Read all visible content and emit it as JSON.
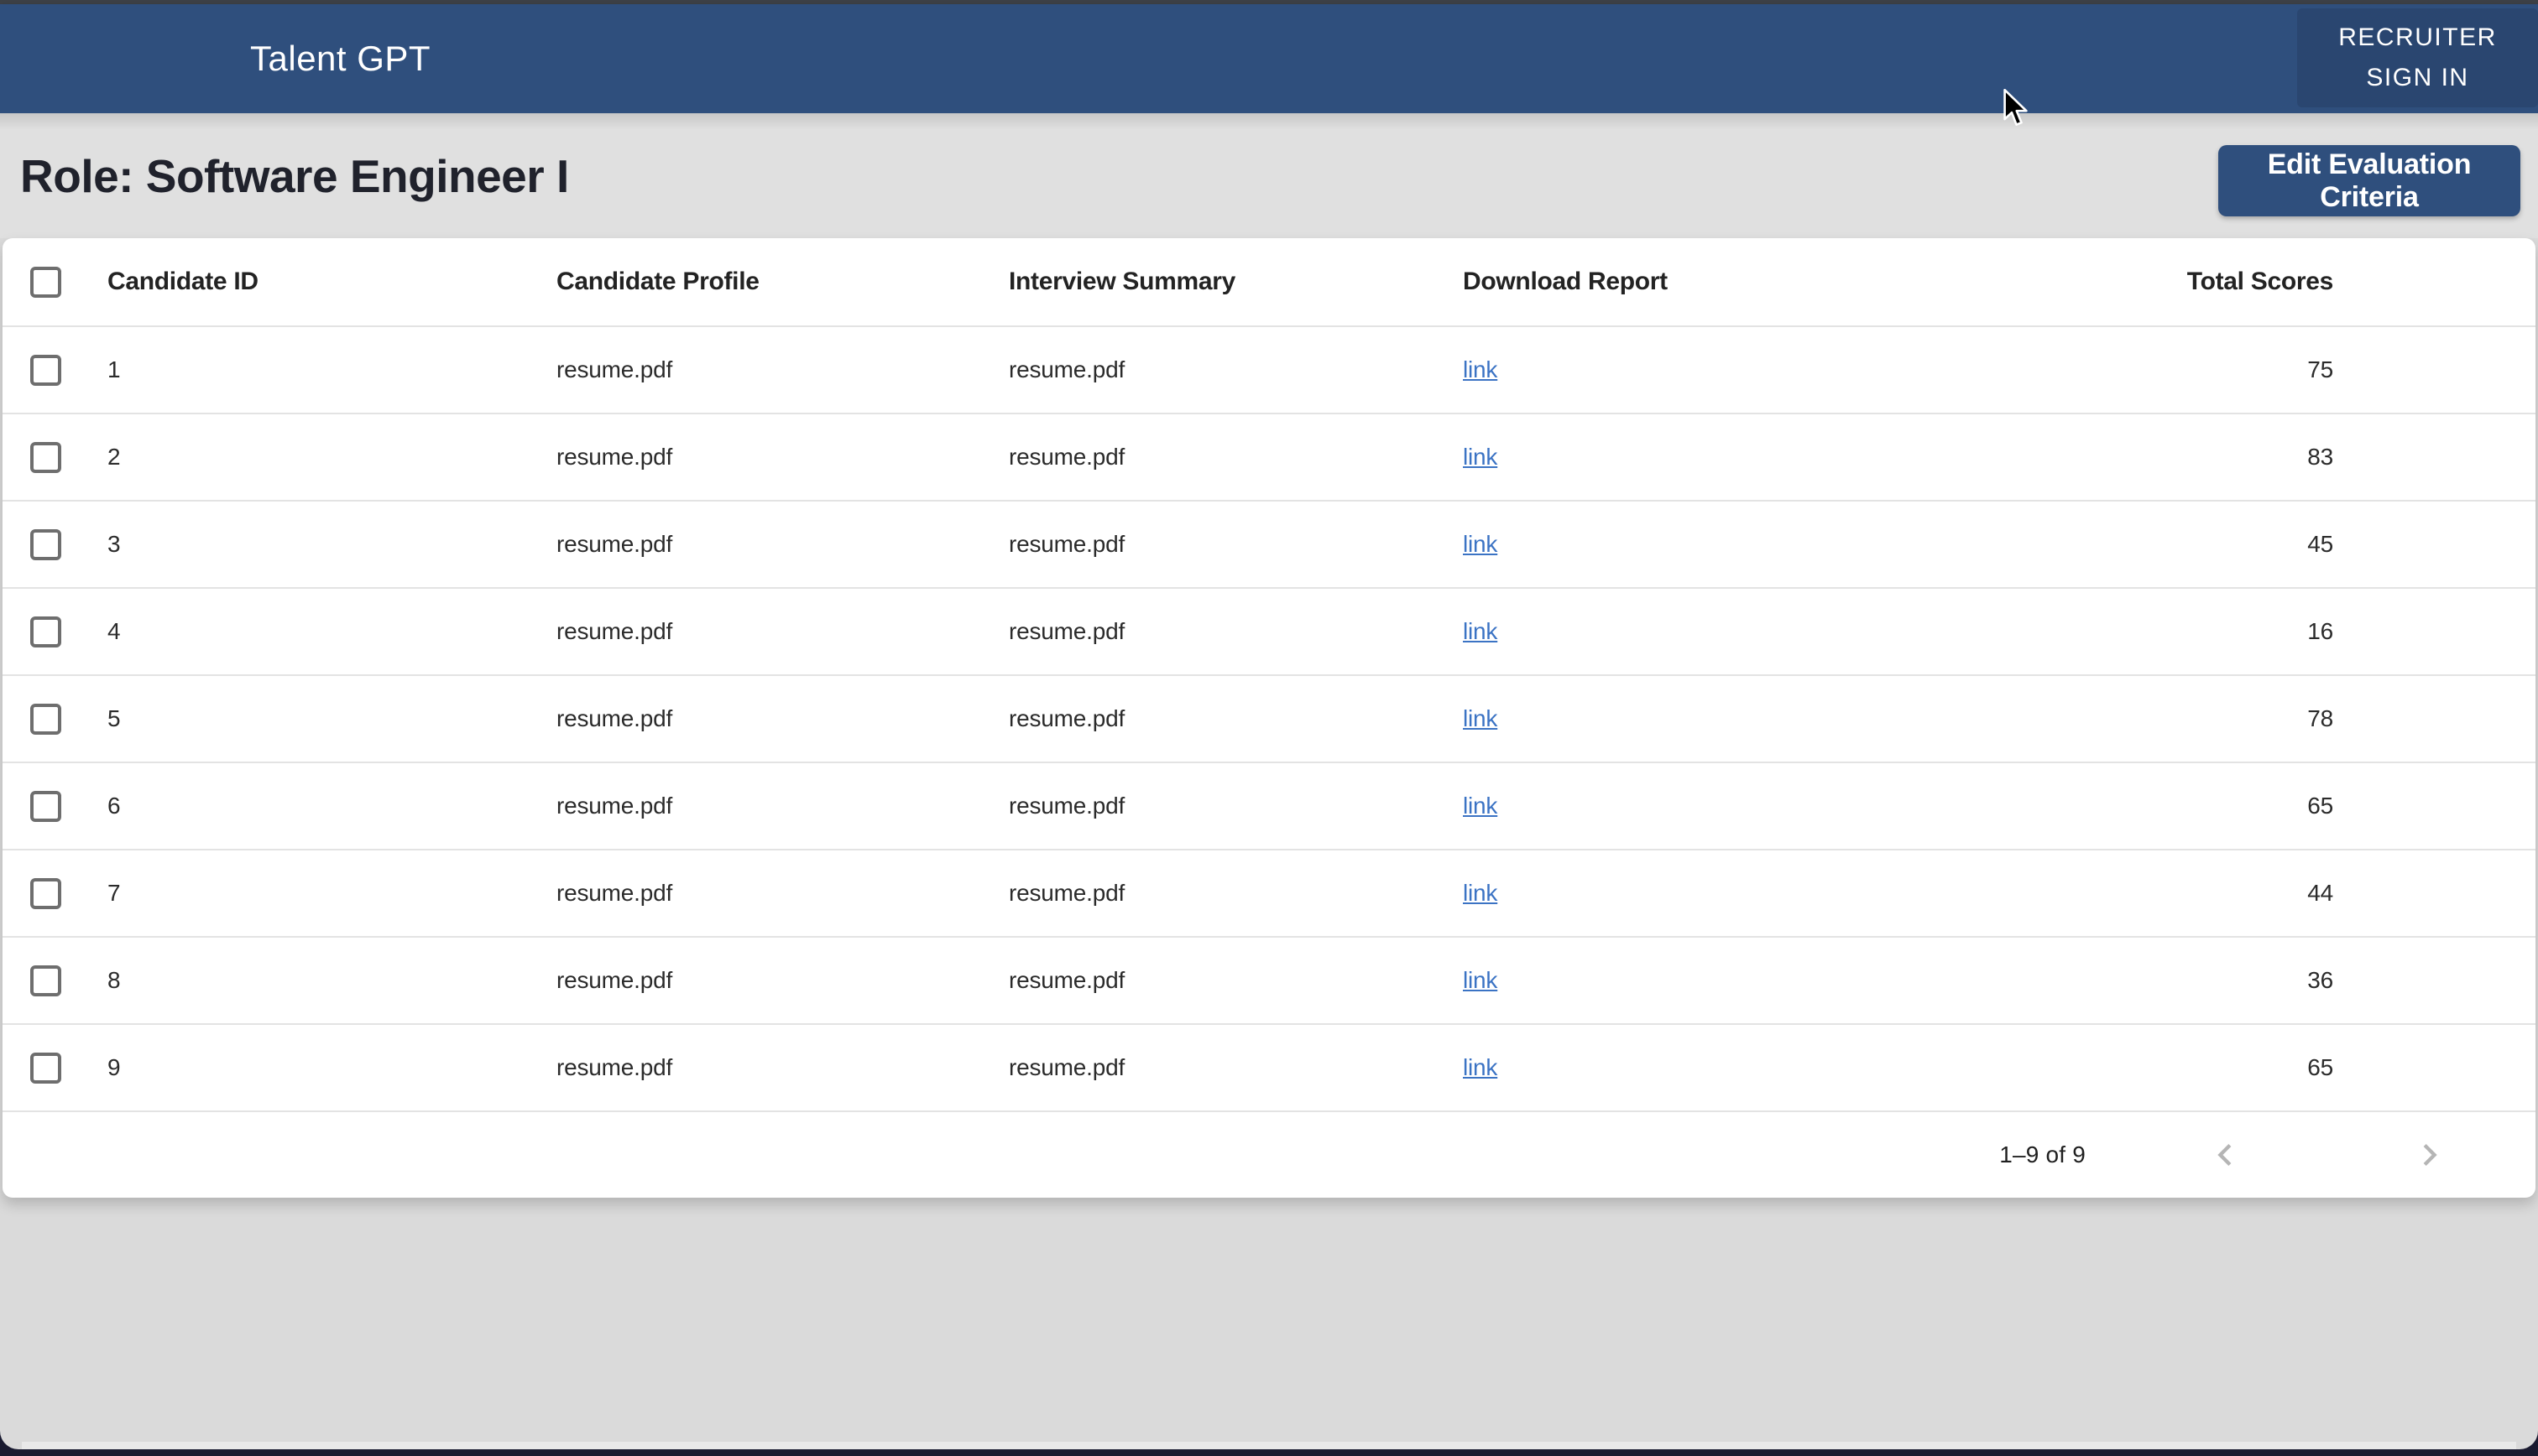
{
  "appbar": {
    "title": "Talent GPT",
    "signin": {
      "line1": "RECRUITER",
      "line2": "SIGN IN"
    }
  },
  "role_bar": {
    "title": "Role: Software Engineer I",
    "edit_button_label": "Edit Evaluation Criteria"
  },
  "table": {
    "columns": {
      "id": "Candidate ID",
      "profile": "Candidate Profile",
      "summary": "Interview Summary",
      "report": "Download Report",
      "scores": "Total Scores"
    },
    "rows": [
      {
        "id": "1",
        "profile": "resume.pdf",
        "summary": "resume.pdf",
        "report_label": "link",
        "score": "75"
      },
      {
        "id": "2",
        "profile": "resume.pdf",
        "summary": "resume.pdf",
        "report_label": "link",
        "score": "83"
      },
      {
        "id": "3",
        "profile": "resume.pdf",
        "summary": "resume.pdf",
        "report_label": "link",
        "score": "45"
      },
      {
        "id": "4",
        "profile": "resume.pdf",
        "summary": "resume.pdf",
        "report_label": "link",
        "score": "16"
      },
      {
        "id": "5",
        "profile": "resume.pdf",
        "summary": "resume.pdf",
        "report_label": "link",
        "score": "78"
      },
      {
        "id": "6",
        "profile": "resume.pdf",
        "summary": "resume.pdf",
        "report_label": "link",
        "score": "65"
      },
      {
        "id": "7",
        "profile": "resume.pdf",
        "summary": "resume.pdf",
        "report_label": "link",
        "score": "44"
      },
      {
        "id": "8",
        "profile": "resume.pdf",
        "summary": "resume.pdf",
        "report_label": "link",
        "score": "36"
      },
      {
        "id": "9",
        "profile": "resume.pdf",
        "summary": "resume.pdf",
        "report_label": "link",
        "score": "65"
      }
    ]
  },
  "pagination": {
    "range_label": "1–9 of 9"
  },
  "colors": {
    "appbar": "#2F4F7D",
    "button": "#2F4F7D",
    "link": "#3B73C4",
    "page_bg": "#E0E0E0",
    "card_bg": "#FFFFFF",
    "outer_bg": "#191A30",
    "chrome": "#3D4147",
    "separator": "#E3E3E3",
    "disabled_icon": "#B5B5B5"
  }
}
